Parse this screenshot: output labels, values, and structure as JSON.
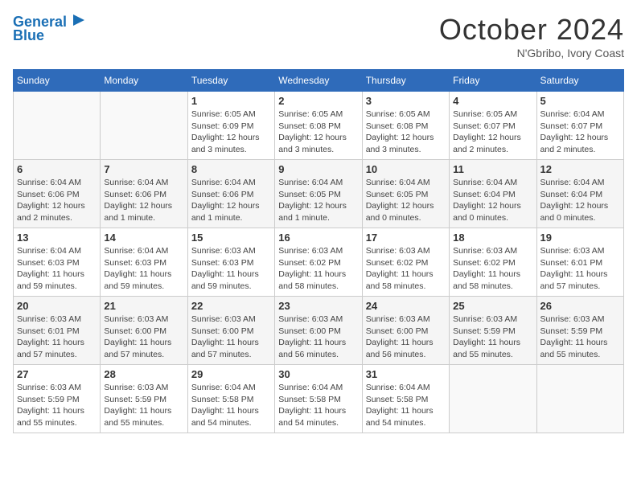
{
  "header": {
    "logo_line1": "General",
    "logo_line2": "Blue",
    "month": "October 2024",
    "location": "N'Gbribo, Ivory Coast"
  },
  "weekdays": [
    "Sunday",
    "Monday",
    "Tuesday",
    "Wednesday",
    "Thursday",
    "Friday",
    "Saturday"
  ],
  "weeks": [
    [
      {
        "day": "",
        "info": ""
      },
      {
        "day": "",
        "info": ""
      },
      {
        "day": "1",
        "info": "Sunrise: 6:05 AM\nSunset: 6:09 PM\nDaylight: 12 hours and 3 minutes."
      },
      {
        "day": "2",
        "info": "Sunrise: 6:05 AM\nSunset: 6:08 PM\nDaylight: 12 hours and 3 minutes."
      },
      {
        "day": "3",
        "info": "Sunrise: 6:05 AM\nSunset: 6:08 PM\nDaylight: 12 hours and 3 minutes."
      },
      {
        "day": "4",
        "info": "Sunrise: 6:05 AM\nSunset: 6:07 PM\nDaylight: 12 hours and 2 minutes."
      },
      {
        "day": "5",
        "info": "Sunrise: 6:04 AM\nSunset: 6:07 PM\nDaylight: 12 hours and 2 minutes."
      }
    ],
    [
      {
        "day": "6",
        "info": "Sunrise: 6:04 AM\nSunset: 6:06 PM\nDaylight: 12 hours and 2 minutes."
      },
      {
        "day": "7",
        "info": "Sunrise: 6:04 AM\nSunset: 6:06 PM\nDaylight: 12 hours and 1 minute."
      },
      {
        "day": "8",
        "info": "Sunrise: 6:04 AM\nSunset: 6:06 PM\nDaylight: 12 hours and 1 minute."
      },
      {
        "day": "9",
        "info": "Sunrise: 6:04 AM\nSunset: 6:05 PM\nDaylight: 12 hours and 1 minute."
      },
      {
        "day": "10",
        "info": "Sunrise: 6:04 AM\nSunset: 6:05 PM\nDaylight: 12 hours and 0 minutes."
      },
      {
        "day": "11",
        "info": "Sunrise: 6:04 AM\nSunset: 6:04 PM\nDaylight: 12 hours and 0 minutes."
      },
      {
        "day": "12",
        "info": "Sunrise: 6:04 AM\nSunset: 6:04 PM\nDaylight: 12 hours and 0 minutes."
      }
    ],
    [
      {
        "day": "13",
        "info": "Sunrise: 6:04 AM\nSunset: 6:03 PM\nDaylight: 11 hours and 59 minutes."
      },
      {
        "day": "14",
        "info": "Sunrise: 6:04 AM\nSunset: 6:03 PM\nDaylight: 11 hours and 59 minutes."
      },
      {
        "day": "15",
        "info": "Sunrise: 6:03 AM\nSunset: 6:03 PM\nDaylight: 11 hours and 59 minutes."
      },
      {
        "day": "16",
        "info": "Sunrise: 6:03 AM\nSunset: 6:02 PM\nDaylight: 11 hours and 58 minutes."
      },
      {
        "day": "17",
        "info": "Sunrise: 6:03 AM\nSunset: 6:02 PM\nDaylight: 11 hours and 58 minutes."
      },
      {
        "day": "18",
        "info": "Sunrise: 6:03 AM\nSunset: 6:02 PM\nDaylight: 11 hours and 58 minutes."
      },
      {
        "day": "19",
        "info": "Sunrise: 6:03 AM\nSunset: 6:01 PM\nDaylight: 11 hours and 57 minutes."
      }
    ],
    [
      {
        "day": "20",
        "info": "Sunrise: 6:03 AM\nSunset: 6:01 PM\nDaylight: 11 hours and 57 minutes."
      },
      {
        "day": "21",
        "info": "Sunrise: 6:03 AM\nSunset: 6:00 PM\nDaylight: 11 hours and 57 minutes."
      },
      {
        "day": "22",
        "info": "Sunrise: 6:03 AM\nSunset: 6:00 PM\nDaylight: 11 hours and 57 minutes."
      },
      {
        "day": "23",
        "info": "Sunrise: 6:03 AM\nSunset: 6:00 PM\nDaylight: 11 hours and 56 minutes."
      },
      {
        "day": "24",
        "info": "Sunrise: 6:03 AM\nSunset: 6:00 PM\nDaylight: 11 hours and 56 minutes."
      },
      {
        "day": "25",
        "info": "Sunrise: 6:03 AM\nSunset: 5:59 PM\nDaylight: 11 hours and 55 minutes."
      },
      {
        "day": "26",
        "info": "Sunrise: 6:03 AM\nSunset: 5:59 PM\nDaylight: 11 hours and 55 minutes."
      }
    ],
    [
      {
        "day": "27",
        "info": "Sunrise: 6:03 AM\nSunset: 5:59 PM\nDaylight: 11 hours and 55 minutes."
      },
      {
        "day": "28",
        "info": "Sunrise: 6:03 AM\nSunset: 5:59 PM\nDaylight: 11 hours and 55 minutes."
      },
      {
        "day": "29",
        "info": "Sunrise: 6:04 AM\nSunset: 5:58 PM\nDaylight: 11 hours and 54 minutes."
      },
      {
        "day": "30",
        "info": "Sunrise: 6:04 AM\nSunset: 5:58 PM\nDaylight: 11 hours and 54 minutes."
      },
      {
        "day": "31",
        "info": "Sunrise: 6:04 AM\nSunset: 5:58 PM\nDaylight: 11 hours and 54 minutes."
      },
      {
        "day": "",
        "info": ""
      },
      {
        "day": "",
        "info": ""
      }
    ]
  ]
}
